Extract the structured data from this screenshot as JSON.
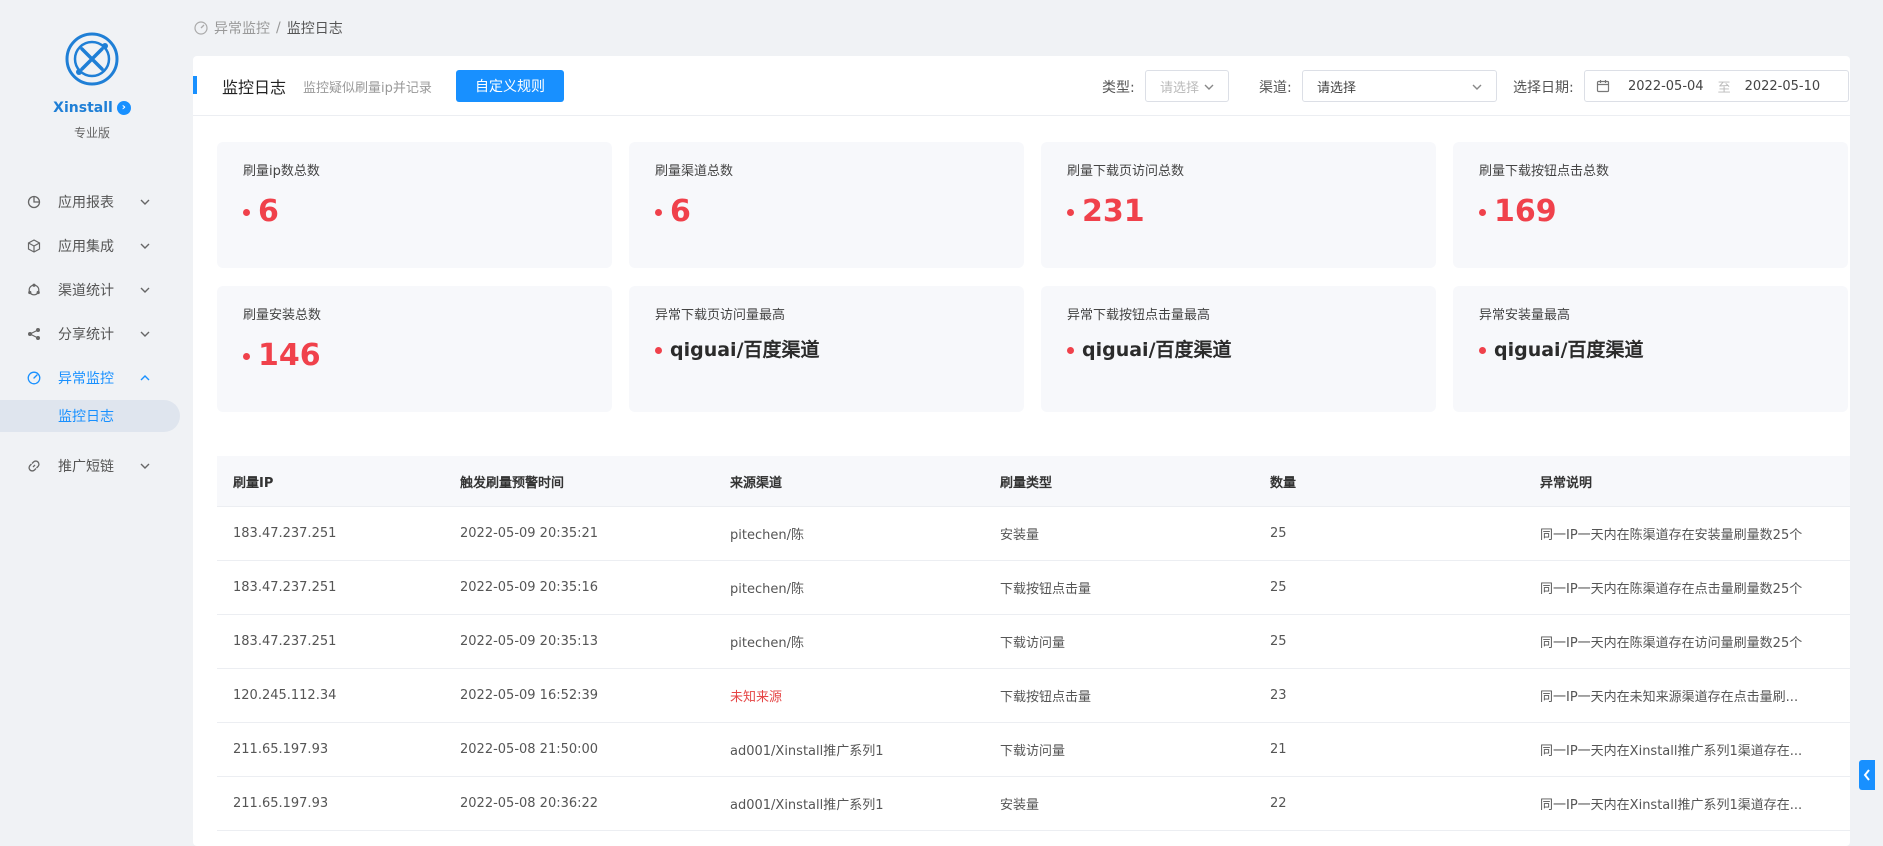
{
  "sidebar": {
    "brand": "Xinstall",
    "edition": "专业版",
    "items": [
      {
        "label": "应用报表"
      },
      {
        "label": "应用集成"
      },
      {
        "label": "渠道统计"
      },
      {
        "label": "分享统计"
      },
      {
        "label": "异常监控",
        "active": true,
        "children": [
          {
            "label": "监控日志"
          }
        ]
      },
      {
        "label": "推广短链"
      }
    ]
  },
  "breadcrumb": {
    "parent": "异常监控",
    "separator": "/",
    "current": "监控日志"
  },
  "header": {
    "title": "监控日志",
    "subtitle": "监控疑似刷量ip并记录",
    "custom_rule_button": "自定义规则",
    "type_label": "类型:",
    "type_placeholder": "请选择",
    "channel_label": "渠道:",
    "channel_value": "请选择",
    "date_label": "选择日期:",
    "date_start": "2022-05-04",
    "date_sep": "至",
    "date_end": "2022-05-10"
  },
  "stats": [
    {
      "label": "刷量ip数总数",
      "value": "6"
    },
    {
      "label": "刷量渠道总数",
      "value": "6"
    },
    {
      "label": "刷量下载页访问总数",
      "value": "231"
    },
    {
      "label": "刷量下载按钮点击总数",
      "value": "169"
    },
    {
      "label": "刷量安装总数",
      "value": "146"
    },
    {
      "label": "异常下载页访问量最高",
      "value": "qiguai/百度渠道"
    },
    {
      "label": "异常下载按钮点击量最高",
      "value": "qiguai/百度渠道"
    },
    {
      "label": "异常安装量最高",
      "value": "qiguai/百度渠道"
    }
  ],
  "table": {
    "columns": [
      "刷量IP",
      "触发刷量预警时间",
      "来源渠道",
      "刷量类型",
      "数量",
      "异常说明"
    ],
    "rows": [
      [
        "183.47.237.251",
        "2022-05-09 20:35:21",
        "pitechen/陈",
        "安装量",
        "25",
        "同一IP一天内在陈渠道存在安装量刷量数25个"
      ],
      [
        "183.47.237.251",
        "2022-05-09 20:35:16",
        "pitechen/陈",
        "下载按钮点击量",
        "25",
        "同一IP一天内在陈渠道存在点击量刷量数25个"
      ],
      [
        "183.47.237.251",
        "2022-05-09 20:35:13",
        "pitechen/陈",
        "下载访问量",
        "25",
        "同一IP一天内在陈渠道存在访问量刷量数25个"
      ],
      [
        "120.245.112.34",
        "2022-05-09 16:52:39",
        "未知来源",
        "下载按钮点击量",
        "23",
        "同一IP一天内在未知来源渠道存在点击量刷..."
      ],
      [
        "211.65.197.93",
        "2022-05-08 21:50:00",
        "ad001/Xinstall推广系列1",
        "下载访问量",
        "21",
        "同一IP一天内在Xinstall推广系列1渠道存在..."
      ],
      [
        "211.65.197.93",
        "2022-05-08 20:36:22",
        "ad001/Xinstall推广系列1",
        "安装量",
        "22",
        "同一IP一天内在Xinstall推广系列1渠道存在..."
      ]
    ]
  },
  "colors": {
    "primary": "#1890ff",
    "alert": "#f0414b"
  }
}
